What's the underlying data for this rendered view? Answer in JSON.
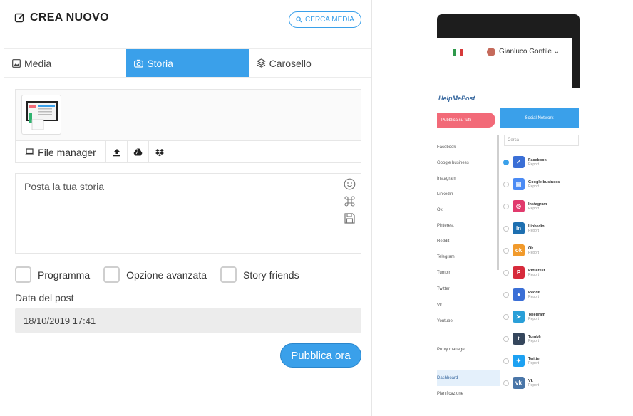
{
  "header": {
    "title": "CREA NUOVO",
    "search_media": "CERCA MEDIA"
  },
  "tabs": [
    {
      "label": "Media",
      "icon": "image-icon",
      "active": false
    },
    {
      "label": "Storia",
      "icon": "camera-icon",
      "active": true
    },
    {
      "label": "Carosello",
      "icon": "layers-icon",
      "active": false
    }
  ],
  "media": {
    "file_manager": "File manager"
  },
  "post": {
    "placeholder": "Posta la tua storia"
  },
  "options": [
    {
      "label": "Programma",
      "checked": false
    },
    {
      "label": "Opzione avanzata",
      "checked": false
    },
    {
      "label": "Story friends",
      "checked": false
    }
  ],
  "date": {
    "label": "Data del post",
    "value": "18/10/2019 17:41"
  },
  "publish_label": "Pubblica ora",
  "colors": {
    "accent": "#3aa0ea",
    "pink": "#f26a78"
  },
  "preview": {
    "user": "Gianluco Gontile",
    "logo": "HelpMePost",
    "publish_all": "Pubblica su tutti",
    "social_network": "Social Network",
    "search": "Cerca",
    "menu": [
      "Facebook",
      "Google business",
      "Instagram",
      "Linkedin",
      "Ok",
      "Pinterest",
      "Reddit",
      "Telegram",
      "Tumblr",
      "Twitter",
      "Vk",
      "Youtube",
      "Proxy manager",
      "Dashboard",
      "Pianificazione"
    ],
    "networks": [
      {
        "name": "Facebook",
        "sub": "Report",
        "color": "#3b6fd6",
        "glyph": "✓",
        "selected": true
      },
      {
        "name": "Google business",
        "sub": "Report",
        "color": "#4a8af4",
        "glyph": "▤",
        "selected": false
      },
      {
        "name": "Instagram",
        "sub": "Report",
        "color": "#e13a6d",
        "glyph": "◎",
        "selected": false
      },
      {
        "name": "Linkedin",
        "sub": "Report",
        "color": "#1d6fb0",
        "glyph": "in",
        "selected": false
      },
      {
        "name": "Ok",
        "sub": "Report",
        "color": "#f19a2b",
        "glyph": "ok",
        "selected": false
      },
      {
        "name": "Pinterest",
        "sub": "Report",
        "color": "#d72a3b",
        "glyph": "P",
        "selected": false
      },
      {
        "name": "Reddit",
        "sub": "Report",
        "color": "#3b6fd6",
        "glyph": "●",
        "selected": false
      },
      {
        "name": "Telegram",
        "sub": "Report",
        "color": "#2a9fd8",
        "glyph": "➤",
        "selected": false
      },
      {
        "name": "Tumblr",
        "sub": "Report",
        "color": "#35465c",
        "glyph": "t",
        "selected": false
      },
      {
        "name": "Twitter",
        "sub": "Report",
        "color": "#1da1f2",
        "glyph": "✦",
        "selected": false
      },
      {
        "name": "Vk",
        "sub": "Report",
        "color": "#4a76a8",
        "glyph": "vk",
        "selected": false
      }
    ]
  }
}
